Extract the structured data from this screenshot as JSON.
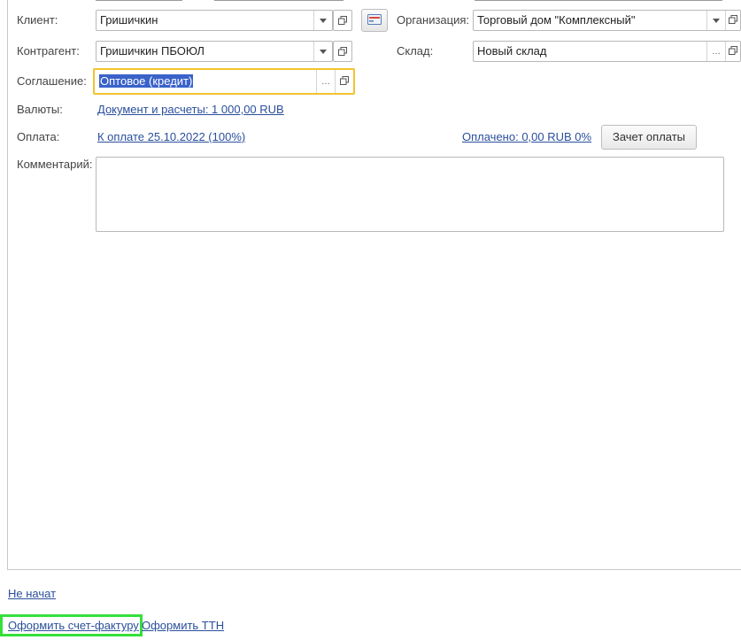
{
  "header": {
    "client_label": "Клиент:",
    "client_value": "Гришичкин",
    "organization_label": "Организация:",
    "organization_value": "Торговый дом \"Комплексный\"",
    "contractor_label": "Контрагент:",
    "contractor_value": "Гришичкин ПБОЮЛ",
    "warehouse_label": "Склад:",
    "warehouse_value": "Новый склад",
    "agreement_label": "Соглашение:",
    "agreement_value": "Оптовое (кредит)",
    "currencies_label": "Валюты:",
    "currencies_link": "Документ и расчеты: 1 000,00 RUB",
    "payment_label": "Оплата:",
    "payment_link": "К оплате 25.10.2022 (100%)",
    "paid_link": "Оплачено: 0,00 RUB 0%",
    "offset_button": "Зачет оплаты",
    "comment_label": "Комментарий:",
    "comment_value": ""
  },
  "icons": {
    "dropdown": "chevron-down-icon",
    "select": "ellipsis-icon",
    "open": "open-form-icon",
    "card": "client-card-icon"
  },
  "footer": {
    "status_link": "Не начат",
    "invoice_link": "Оформить счет-фактуру",
    "ttn_link": "Оформить ТТН"
  },
  "colors": {
    "link": "#2a4f9c",
    "focus_border": "#f2c330",
    "highlight_border": "#35e03a",
    "selection": "#3a62c9"
  }
}
